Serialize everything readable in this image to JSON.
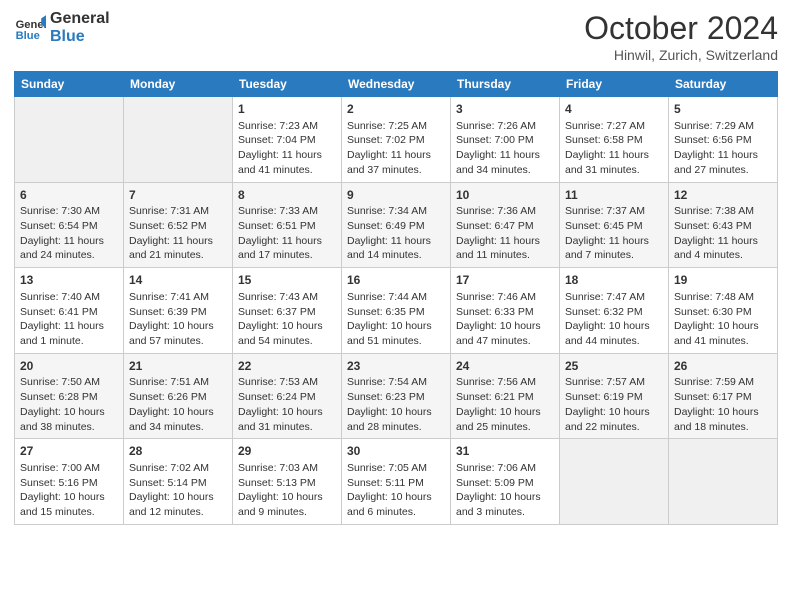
{
  "header": {
    "logo_line1": "General",
    "logo_line2": "Blue",
    "month": "October 2024",
    "location": "Hinwil, Zurich, Switzerland"
  },
  "weekdays": [
    "Sunday",
    "Monday",
    "Tuesday",
    "Wednesday",
    "Thursday",
    "Friday",
    "Saturday"
  ],
  "weeks": [
    [
      {
        "day": "",
        "sunrise": "",
        "sunset": "",
        "daylight": ""
      },
      {
        "day": "",
        "sunrise": "",
        "sunset": "",
        "daylight": ""
      },
      {
        "day": "1",
        "sunrise": "Sunrise: 7:23 AM",
        "sunset": "Sunset: 7:04 PM",
        "daylight": "Daylight: 11 hours and 41 minutes."
      },
      {
        "day": "2",
        "sunrise": "Sunrise: 7:25 AM",
        "sunset": "Sunset: 7:02 PM",
        "daylight": "Daylight: 11 hours and 37 minutes."
      },
      {
        "day": "3",
        "sunrise": "Sunrise: 7:26 AM",
        "sunset": "Sunset: 7:00 PM",
        "daylight": "Daylight: 11 hours and 34 minutes."
      },
      {
        "day": "4",
        "sunrise": "Sunrise: 7:27 AM",
        "sunset": "Sunset: 6:58 PM",
        "daylight": "Daylight: 11 hours and 31 minutes."
      },
      {
        "day": "5",
        "sunrise": "Sunrise: 7:29 AM",
        "sunset": "Sunset: 6:56 PM",
        "daylight": "Daylight: 11 hours and 27 minutes."
      }
    ],
    [
      {
        "day": "6",
        "sunrise": "Sunrise: 7:30 AM",
        "sunset": "Sunset: 6:54 PM",
        "daylight": "Daylight: 11 hours and 24 minutes."
      },
      {
        "day": "7",
        "sunrise": "Sunrise: 7:31 AM",
        "sunset": "Sunset: 6:52 PM",
        "daylight": "Daylight: 11 hours and 21 minutes."
      },
      {
        "day": "8",
        "sunrise": "Sunrise: 7:33 AM",
        "sunset": "Sunset: 6:51 PM",
        "daylight": "Daylight: 11 hours and 17 minutes."
      },
      {
        "day": "9",
        "sunrise": "Sunrise: 7:34 AM",
        "sunset": "Sunset: 6:49 PM",
        "daylight": "Daylight: 11 hours and 14 minutes."
      },
      {
        "day": "10",
        "sunrise": "Sunrise: 7:36 AM",
        "sunset": "Sunset: 6:47 PM",
        "daylight": "Daylight: 11 hours and 11 minutes."
      },
      {
        "day": "11",
        "sunrise": "Sunrise: 7:37 AM",
        "sunset": "Sunset: 6:45 PM",
        "daylight": "Daylight: 11 hours and 7 minutes."
      },
      {
        "day": "12",
        "sunrise": "Sunrise: 7:38 AM",
        "sunset": "Sunset: 6:43 PM",
        "daylight": "Daylight: 11 hours and 4 minutes."
      }
    ],
    [
      {
        "day": "13",
        "sunrise": "Sunrise: 7:40 AM",
        "sunset": "Sunset: 6:41 PM",
        "daylight": "Daylight: 11 hours and 1 minute."
      },
      {
        "day": "14",
        "sunrise": "Sunrise: 7:41 AM",
        "sunset": "Sunset: 6:39 PM",
        "daylight": "Daylight: 10 hours and 57 minutes."
      },
      {
        "day": "15",
        "sunrise": "Sunrise: 7:43 AM",
        "sunset": "Sunset: 6:37 PM",
        "daylight": "Daylight: 10 hours and 54 minutes."
      },
      {
        "day": "16",
        "sunrise": "Sunrise: 7:44 AM",
        "sunset": "Sunset: 6:35 PM",
        "daylight": "Daylight: 10 hours and 51 minutes."
      },
      {
        "day": "17",
        "sunrise": "Sunrise: 7:46 AM",
        "sunset": "Sunset: 6:33 PM",
        "daylight": "Daylight: 10 hours and 47 minutes."
      },
      {
        "day": "18",
        "sunrise": "Sunrise: 7:47 AM",
        "sunset": "Sunset: 6:32 PM",
        "daylight": "Daylight: 10 hours and 44 minutes."
      },
      {
        "day": "19",
        "sunrise": "Sunrise: 7:48 AM",
        "sunset": "Sunset: 6:30 PM",
        "daylight": "Daylight: 10 hours and 41 minutes."
      }
    ],
    [
      {
        "day": "20",
        "sunrise": "Sunrise: 7:50 AM",
        "sunset": "Sunset: 6:28 PM",
        "daylight": "Daylight: 10 hours and 38 minutes."
      },
      {
        "day": "21",
        "sunrise": "Sunrise: 7:51 AM",
        "sunset": "Sunset: 6:26 PM",
        "daylight": "Daylight: 10 hours and 34 minutes."
      },
      {
        "day": "22",
        "sunrise": "Sunrise: 7:53 AM",
        "sunset": "Sunset: 6:24 PM",
        "daylight": "Daylight: 10 hours and 31 minutes."
      },
      {
        "day": "23",
        "sunrise": "Sunrise: 7:54 AM",
        "sunset": "Sunset: 6:23 PM",
        "daylight": "Daylight: 10 hours and 28 minutes."
      },
      {
        "day": "24",
        "sunrise": "Sunrise: 7:56 AM",
        "sunset": "Sunset: 6:21 PM",
        "daylight": "Daylight: 10 hours and 25 minutes."
      },
      {
        "day": "25",
        "sunrise": "Sunrise: 7:57 AM",
        "sunset": "Sunset: 6:19 PM",
        "daylight": "Daylight: 10 hours and 22 minutes."
      },
      {
        "day": "26",
        "sunrise": "Sunrise: 7:59 AM",
        "sunset": "Sunset: 6:17 PM",
        "daylight": "Daylight: 10 hours and 18 minutes."
      }
    ],
    [
      {
        "day": "27",
        "sunrise": "Sunrise: 7:00 AM",
        "sunset": "Sunset: 5:16 PM",
        "daylight": "Daylight: 10 hours and 15 minutes."
      },
      {
        "day": "28",
        "sunrise": "Sunrise: 7:02 AM",
        "sunset": "Sunset: 5:14 PM",
        "daylight": "Daylight: 10 hours and 12 minutes."
      },
      {
        "day": "29",
        "sunrise": "Sunrise: 7:03 AM",
        "sunset": "Sunset: 5:13 PM",
        "daylight": "Daylight: 10 hours and 9 minutes."
      },
      {
        "day": "30",
        "sunrise": "Sunrise: 7:05 AM",
        "sunset": "Sunset: 5:11 PM",
        "daylight": "Daylight: 10 hours and 6 minutes."
      },
      {
        "day": "31",
        "sunrise": "Sunrise: 7:06 AM",
        "sunset": "Sunset: 5:09 PM",
        "daylight": "Daylight: 10 hours and 3 minutes."
      },
      {
        "day": "",
        "sunrise": "",
        "sunset": "",
        "daylight": ""
      },
      {
        "day": "",
        "sunrise": "",
        "sunset": "",
        "daylight": ""
      }
    ]
  ]
}
